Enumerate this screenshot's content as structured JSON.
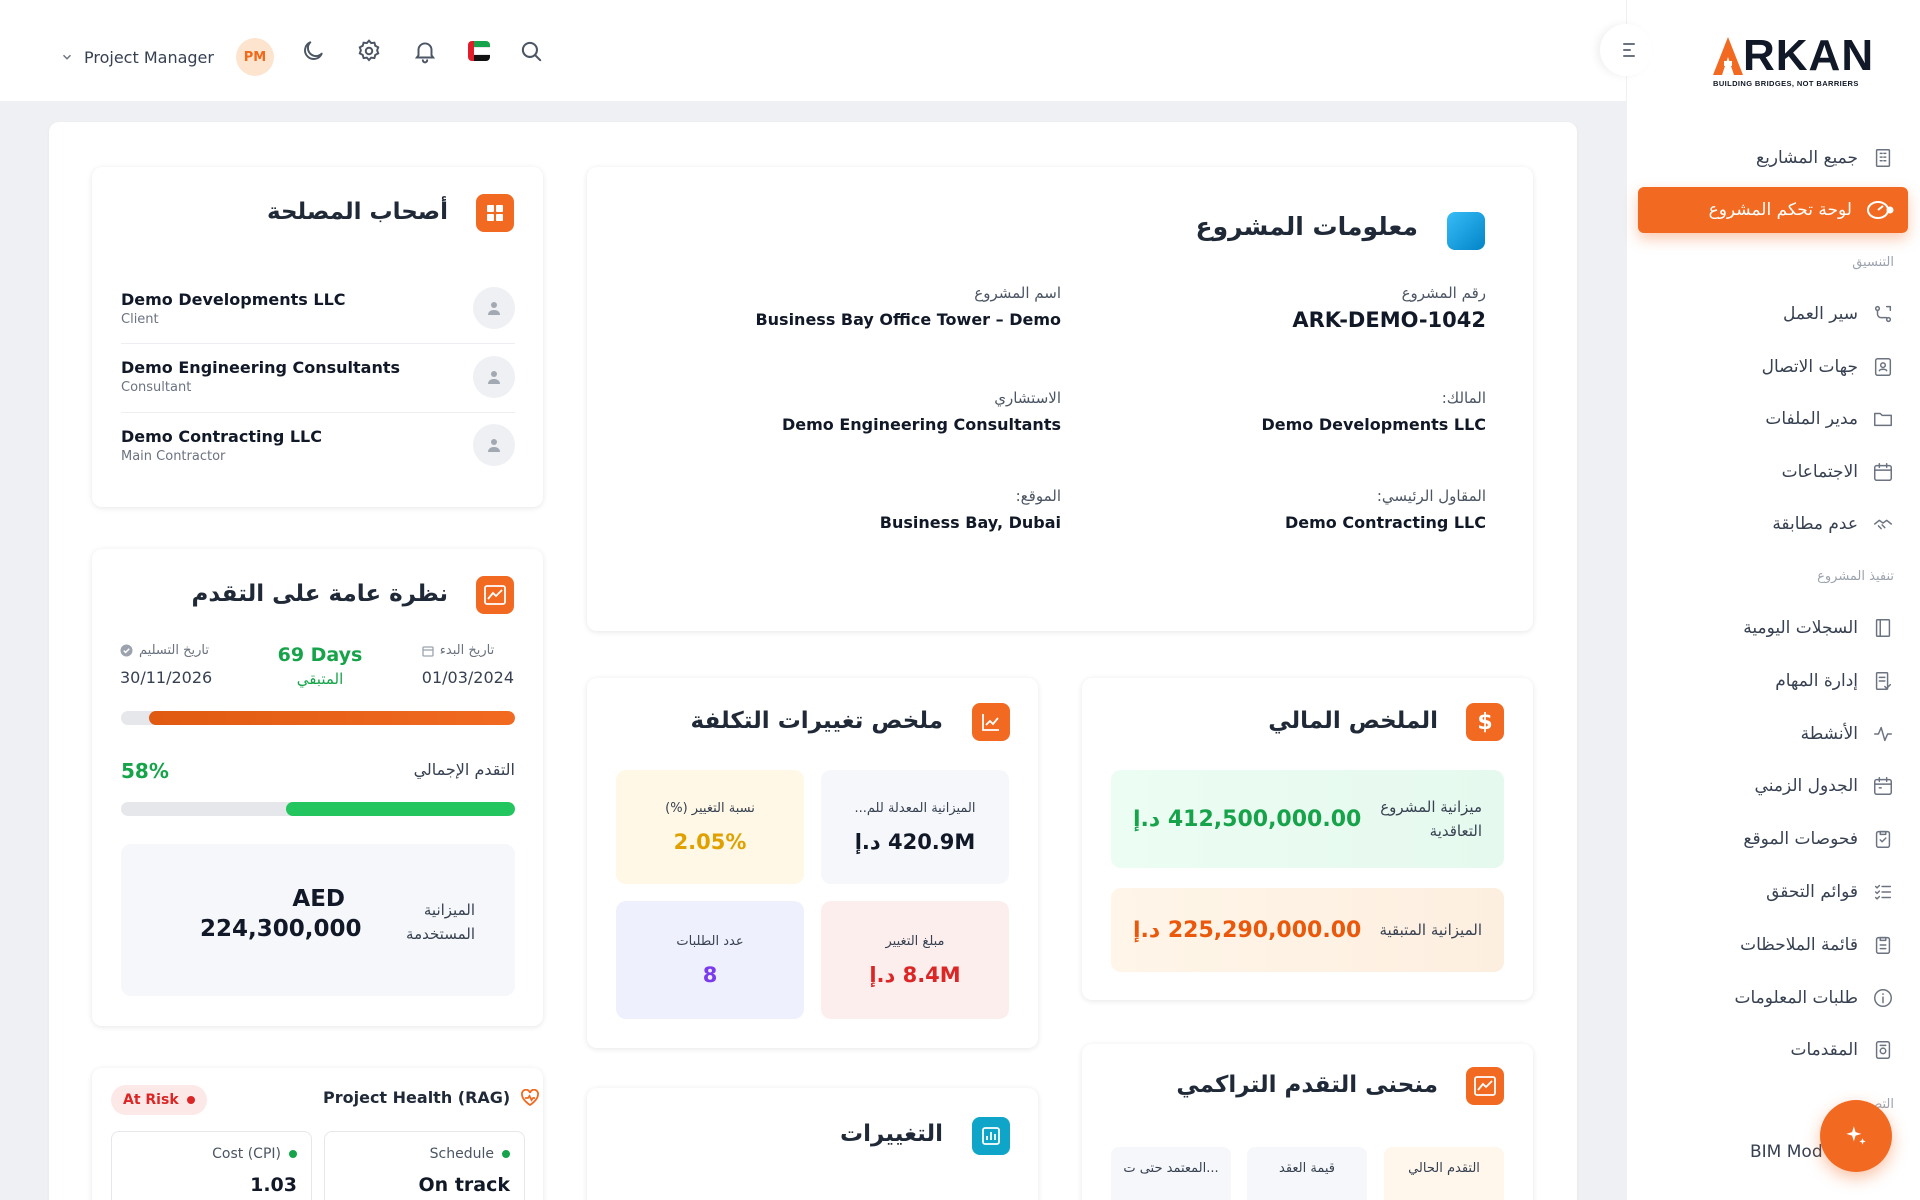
{
  "topbar": {
    "user_role": "Project Manager",
    "avatar_initials": "PM"
  },
  "logo": {
    "text": "RKAN",
    "tagline": "BUILDING BRIDGES, NOT BARRIERS"
  },
  "sidebar": {
    "items_top": [
      {
        "label": "جميع المشاريع",
        "icon": "building-icon"
      }
    ],
    "active_item": {
      "label": "لوحة تحكم المشروع",
      "icon": "dashboard-gauge-icon"
    },
    "section_coordination": "التنسيق",
    "coordination_items": [
      {
        "label": "سير العمل",
        "icon": "workflow-icon"
      },
      {
        "label": "جهات الاتصال",
        "icon": "contacts-icon"
      },
      {
        "label": "مدير الملفات",
        "icon": "folder-icon"
      },
      {
        "label": "الاجتماعات",
        "icon": "calendar-icon"
      },
      {
        "label": "عدم مطابقة",
        "icon": "handshake-icon"
      }
    ],
    "section_execution": "تنفيذ المشروع",
    "execution_items": [
      {
        "label": "السجلات اليومية",
        "icon": "book-icon"
      },
      {
        "label": "إدارة المهام",
        "icon": "task-icon"
      },
      {
        "label": "الأنشطة",
        "icon": "activity-icon"
      },
      {
        "label": "الجدول الزمني",
        "icon": "schedule-icon"
      },
      {
        "label": "فحوصات الموقع",
        "icon": "clipboard-check-icon"
      },
      {
        "label": "قوائم التحقق",
        "icon": "checklist-icon"
      },
      {
        "label": "قائمة الملاحظات",
        "icon": "clipboard-icon"
      },
      {
        "label": "طلبات المعلومات",
        "icon": "info-icon"
      },
      {
        "label": "المقدمات",
        "icon": "submittal-icon"
      }
    ],
    "partial_section": "التص",
    "partial_item": "BIM Mod"
  },
  "project_info": {
    "title": "معلومات المشروع",
    "project_number_label": "رقم المشروع",
    "project_number": "ARK-DEMO-1042",
    "project_name_label": "اسم المشروع",
    "project_name": "Business Bay Office Tower – Demo",
    "owner_label": "المالك:",
    "owner": "Demo Developments LLC",
    "consultant_label": "الاستشاري",
    "consultant": "Demo Engineering Consultants",
    "contractor_label": "المقاول الرئيسي:",
    "contractor": "Demo Contracting LLC",
    "location_label": "الموقع:",
    "location": "Business Bay, Dubai"
  },
  "stakeholders": {
    "title": "أصحاب المصلحة",
    "items": [
      {
        "name": "Demo Developments LLC",
        "role": "Client"
      },
      {
        "name": "Demo Engineering Consultants",
        "role": "Consultant"
      },
      {
        "name": "Demo Contracting LLC",
        "role": "Main Contractor"
      }
    ]
  },
  "progress": {
    "title": "نظرة عامة على التقدم",
    "start_label": "تاريخ البدء",
    "start_date": "01/03/2024",
    "remaining_value": "69 Days",
    "remaining_label": "المتبقي",
    "delivery_label": "تاريخ التسليم",
    "delivery_date": "30/11/2026",
    "time_elapsed_fraction": 0.93,
    "overall_label": "التقدم الإجمالي",
    "overall_pct_text": "58%",
    "overall_fraction": 0.58,
    "budget_used_label": "الميزانية المستخدمة",
    "budget_used_currency": "AED",
    "budget_used_value": "224,300,000"
  },
  "health": {
    "title": "Project Health (RAG)",
    "status": "At Risk",
    "schedule_label": "Schedule",
    "schedule_value": "On track",
    "cost_label": "Cost (CPI)",
    "cost_value": "1.03"
  },
  "financial": {
    "title": "الملخص المالي",
    "contract_budget_label": "ميزانية المشروع التعاقدية",
    "contract_budget_value": "412,500,000.00 د.إ",
    "remaining_budget_label": "الميزانية المتبقية",
    "remaining_budget_value": "225,290,000.00 د.إ"
  },
  "cost_changes": {
    "title": "ملخص تغييرات التكلفة",
    "revised_budget_label": "الميزانية المعدلة للم...",
    "revised_budget_value": "420.9M د.إ",
    "change_pct_label": "نسبة التغيير (%)",
    "change_pct_value": "2.05%",
    "change_amount_label": "مبلغ التغيير",
    "change_amount_value": "8.4M د.إ",
    "requests_label": "عدد الطلبات",
    "requests_value": "8"
  },
  "changes": {
    "title": "التغييرات"
  },
  "cumulative": {
    "title": "منحنى التقدم التراكمي",
    "current_progress_label": "التقدم الحالي",
    "contract_value_label": "قيمة العقد",
    "approved_label": "المعتمد حتى ت..."
  },
  "colors": {
    "brand_orange": "#f26a21",
    "green": "#16a34a",
    "red": "#dc2626",
    "amber": "#e0a100",
    "purple": "#7c3aed"
  }
}
